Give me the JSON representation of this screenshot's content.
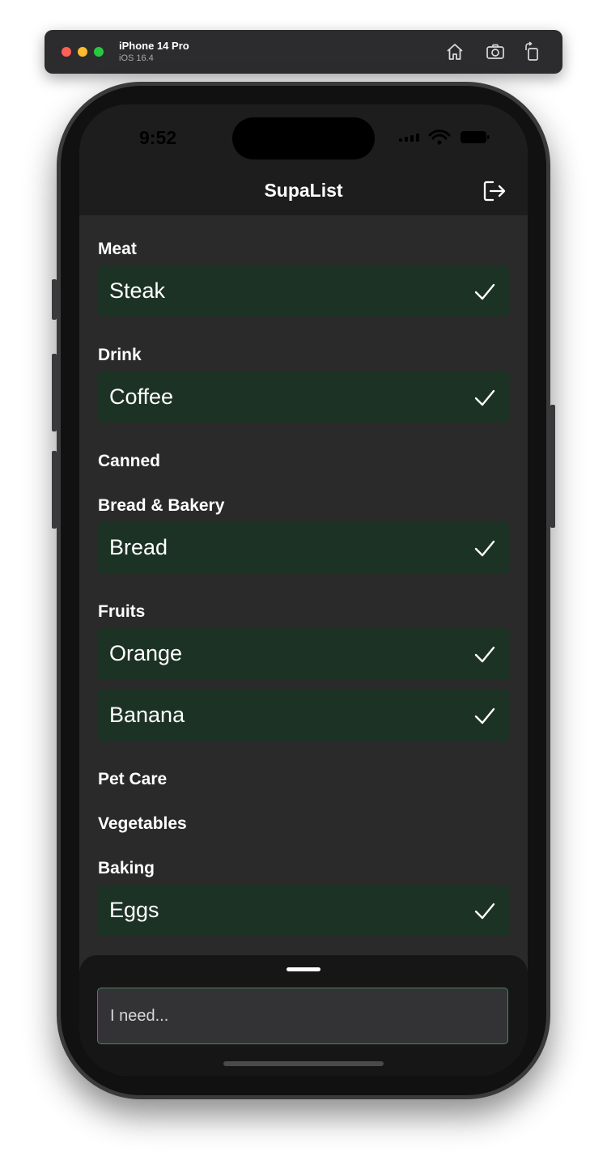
{
  "simulator": {
    "device_name": "iPhone 14 Pro",
    "os_version": "iOS 16.4",
    "home_icon": "home-icon",
    "screenshot_icon": "camera-icon",
    "rotate_icon": "rotate-icon",
    "colors": {
      "close": "#fe5f57",
      "minimize": "#febc2e",
      "zoom": "#28c840"
    }
  },
  "status_bar": {
    "time": "9:52"
  },
  "app": {
    "title": "SupaList",
    "logout_icon": "logout-icon"
  },
  "categories": [
    {
      "name": "Meat",
      "items": [
        "Steak"
      ]
    },
    {
      "name": "Drink",
      "items": [
        "Coffee"
      ]
    },
    {
      "name": "Canned",
      "items": []
    },
    {
      "name": "Bread & Bakery",
      "items": [
        "Bread"
      ]
    },
    {
      "name": "Fruits",
      "items": [
        "Orange",
        "Banana"
      ]
    },
    {
      "name": "Pet Care",
      "items": []
    },
    {
      "name": "Vegetables",
      "items": []
    },
    {
      "name": "Baking",
      "items": [
        "Eggs"
      ]
    }
  ],
  "check_icon": "checkmark-icon",
  "add_item": {
    "placeholder": "I need...",
    "value": ""
  },
  "colors": {
    "item_background": "#1c3224",
    "screen_background": "#2a2a2b",
    "accent_border": "#3c8c5a"
  }
}
